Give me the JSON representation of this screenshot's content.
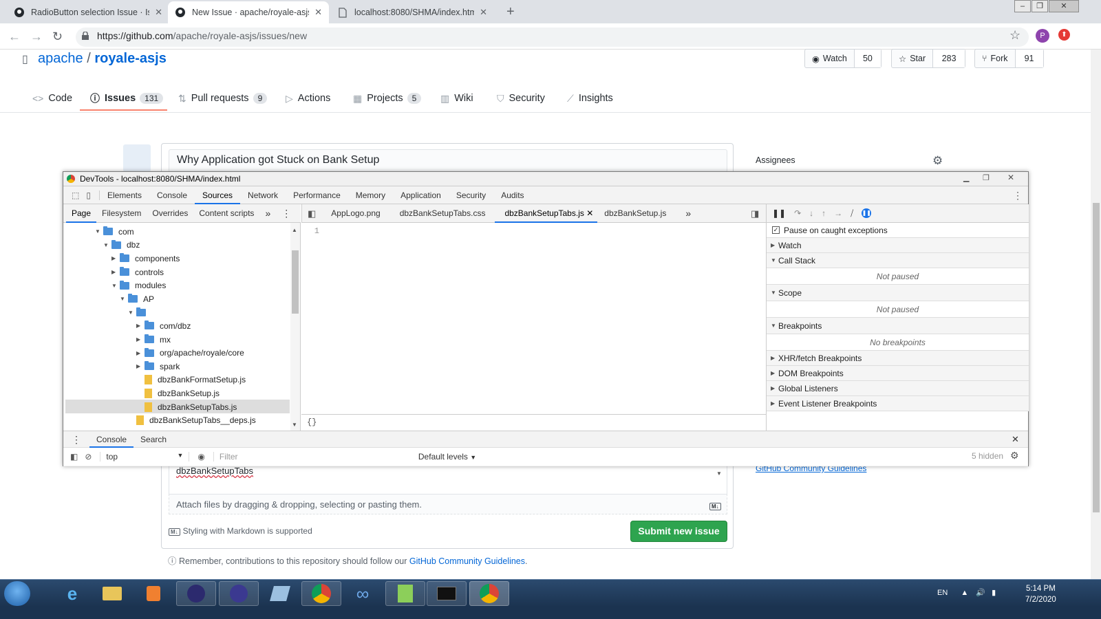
{
  "browser": {
    "tabs": [
      {
        "title": "RadioButton selection Issue · Issu",
        "icon": "github-icon",
        "active": false
      },
      {
        "title": "New Issue · apache/royale-asjs",
        "icon": "github-icon",
        "active": true
      },
      {
        "title": "localhost:8080/SHMA/index.html",
        "icon": "page-icon",
        "active": false
      }
    ],
    "url_host": "https://github.com",
    "url_path": "/apache/royale-asjs/issues/new",
    "profile_initial": "P"
  },
  "repo": {
    "owner": "apache",
    "separator": "/",
    "name": "royale-asjs",
    "watch_label": "Watch",
    "watch_count": "50",
    "star_label": "Star",
    "star_count": "283",
    "fork_label": "Fork",
    "fork_count": "91"
  },
  "nav": [
    {
      "label": "Code",
      "icon": "code-icon",
      "count": ""
    },
    {
      "label": "Issues",
      "icon": "issue-icon",
      "count": "131"
    },
    {
      "label": "Pull requests",
      "icon": "pull-request-icon",
      "count": "9"
    },
    {
      "label": "Actions",
      "icon": "play-icon",
      "count": ""
    },
    {
      "label": "Projects",
      "icon": "project-icon",
      "count": "5"
    },
    {
      "label": "Wiki",
      "icon": "book-icon",
      "count": ""
    },
    {
      "label": "Security",
      "icon": "shield-icon",
      "count": ""
    },
    {
      "label": "Insights",
      "icon": "graph-icon",
      "count": ""
    }
  ],
  "issue": {
    "title_value": "Why Application got Stuck on Bank Setup",
    "comment_text": "dbzBankSetupTabs",
    "attach_text": "Attach files by dragging & dropping, selecting or pasting them.",
    "markdown_badge": "M↓",
    "markdown_note": "Styling with Markdown is supported",
    "submit_label": "Submit new issue",
    "remember_text": "Remember, contributions to this repository should follow our",
    "remember_link": "GitHub Community Guidelines",
    "remember_end": ".",
    "sidebar_assignees": "Assignees",
    "sidebar_guidelines": "GitHub Community Guidelines"
  },
  "devtools": {
    "window_title": "DevTools - localhost:8080/SHMA/index.html",
    "main_tabs": [
      "Elements",
      "Console",
      "Sources",
      "Network",
      "Performance",
      "Memory",
      "Application",
      "Security",
      "Audits"
    ],
    "selected_main_tab": "Sources",
    "nav_tabs": [
      "Page",
      "Filesystem",
      "Overrides",
      "Content scripts"
    ],
    "file_tabs": [
      "AppLogo.png",
      "dbzBankSetupTabs.css",
      "dbzBankSetupTabs.js",
      "dbzBankSetup.js"
    ],
    "active_file_tab": "dbzBankSetupTabs.js",
    "tree": [
      {
        "label": "com",
        "type": "folder",
        "arrow": "▼"
      },
      {
        "label": "dbz",
        "type": "folder",
        "arrow": "▼"
      },
      {
        "label": "components",
        "type": "folder",
        "arrow": "▶"
      },
      {
        "label": "controls",
        "type": "folder",
        "arrow": "▶"
      },
      {
        "label": "modules",
        "type": "folder",
        "arrow": "▼"
      },
      {
        "label": "AP",
        "type": "folder",
        "arrow": "▼"
      },
      {
        "label": "",
        "type": "folder",
        "arrow": "▼"
      },
      {
        "label": "com/dbz",
        "type": "folder",
        "arrow": "▶"
      },
      {
        "label": "mx",
        "type": "folder",
        "arrow": "▶"
      },
      {
        "label": "org/apache/royale/core",
        "type": "folder",
        "arrow": "▶"
      },
      {
        "label": "spark",
        "type": "folder",
        "arrow": "▶"
      },
      {
        "label": "dbzBankFormatSetup.js",
        "type": "file",
        "arrow": ""
      },
      {
        "label": "dbzBankSetup.js",
        "type": "file",
        "arrow": ""
      },
      {
        "label": "dbzBankSetupTabs.js",
        "type": "file",
        "arrow": ""
      },
      {
        "label": "dbzBankSetupTabs__deps.js",
        "type": "file",
        "arrow": ""
      }
    ],
    "line_number": "1",
    "editor_footer": "{}",
    "pause_on_caught": "Pause on caught exceptions",
    "sections": {
      "watch": "Watch",
      "call_stack": "Call Stack",
      "call_stack_note": "Not paused",
      "scope": "Scope",
      "scope_note": "Not paused",
      "breakpoints": "Breakpoints",
      "breakpoints_note": "No breakpoints",
      "xhr": "XHR/fetch Breakpoints",
      "dom": "DOM Breakpoints",
      "global": "Global Listeners",
      "event": "Event Listener Breakpoints"
    },
    "drawer_tabs": [
      "Console",
      "Search"
    ],
    "context": "top",
    "filter_placeholder": "Filter",
    "levels": "Default levels",
    "hidden_count": "5 hidden"
  },
  "taskbar": {
    "language": "EN",
    "time": "5:14 PM",
    "date": "7/2/2020"
  }
}
